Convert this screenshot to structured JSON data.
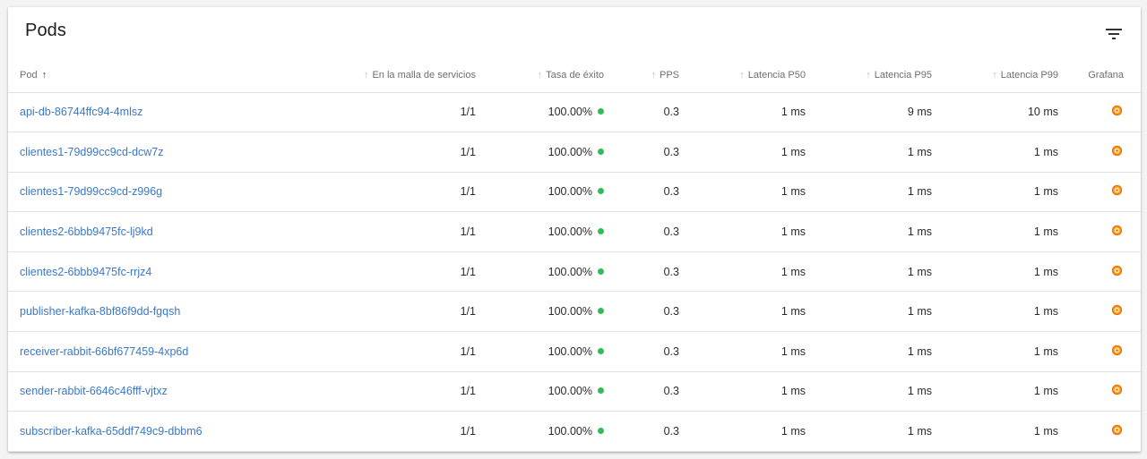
{
  "title": "Pods",
  "icons": {
    "filter": "filter-icon",
    "grafana": "grafana-icon",
    "sort": "arrow-up-icon"
  },
  "colors": {
    "link": "#3a78c7",
    "status_ok": "#2ebd59",
    "grafana": "#f46800"
  },
  "columns": {
    "pod": "Pod",
    "mesh": "En la malla de servicios",
    "success": "Tasa de éxito",
    "pps": "PPS",
    "p50": "Latencia P50",
    "p95": "Latencia P95",
    "p99": "Latencia P99",
    "grafana": "Grafana"
  },
  "rows": [
    {
      "pod": "api-db-86744ffc94-4mlsz",
      "mesh": "1/1",
      "success": "100.00%",
      "pps": "0.3",
      "p50": "1 ms",
      "p95": "9 ms",
      "p99": "10 ms"
    },
    {
      "pod": "clientes1-79d99cc9cd-dcw7z",
      "mesh": "1/1",
      "success": "100.00%",
      "pps": "0.3",
      "p50": "1 ms",
      "p95": "1 ms",
      "p99": "1 ms"
    },
    {
      "pod": "clientes1-79d99cc9cd-z996g",
      "mesh": "1/1",
      "success": "100.00%",
      "pps": "0.3",
      "p50": "1 ms",
      "p95": "1 ms",
      "p99": "1 ms"
    },
    {
      "pod": "clientes2-6bbb9475fc-lj9kd",
      "mesh": "1/1",
      "success": "100.00%",
      "pps": "0.3",
      "p50": "1 ms",
      "p95": "1 ms",
      "p99": "1 ms"
    },
    {
      "pod": "clientes2-6bbb9475fc-rrjz4",
      "mesh": "1/1",
      "success": "100.00%",
      "pps": "0.3",
      "p50": "1 ms",
      "p95": "1 ms",
      "p99": "1 ms"
    },
    {
      "pod": "publisher-kafka-8bf86f9dd-fgqsh",
      "mesh": "1/1",
      "success": "100.00%",
      "pps": "0.3",
      "p50": "1 ms",
      "p95": "1 ms",
      "p99": "1 ms"
    },
    {
      "pod": "receiver-rabbit-66bf677459-4xp6d",
      "mesh": "1/1",
      "success": "100.00%",
      "pps": "0.3",
      "p50": "1 ms",
      "p95": "1 ms",
      "p99": "1 ms"
    },
    {
      "pod": "sender-rabbit-6646c46fff-vjtxz",
      "mesh": "1/1",
      "success": "100.00%",
      "pps": "0.3",
      "p50": "1 ms",
      "p95": "1 ms",
      "p99": "1 ms"
    },
    {
      "pod": "subscriber-kafka-65ddf749c9-dbbm6",
      "mesh": "1/1",
      "success": "100.00%",
      "pps": "0.3",
      "p50": "1 ms",
      "p95": "1 ms",
      "p99": "1 ms"
    }
  ]
}
